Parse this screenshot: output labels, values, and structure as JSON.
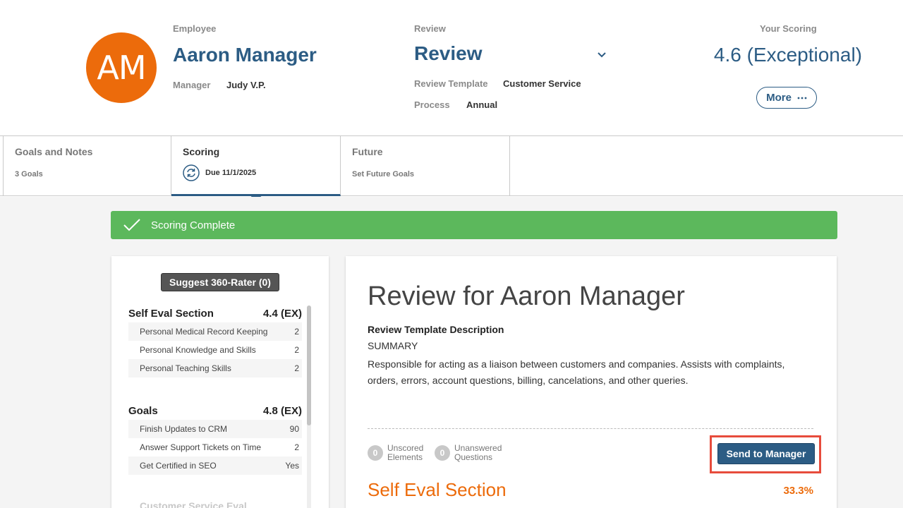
{
  "employee": {
    "label": "Employee",
    "initials": "AM",
    "name": "Aaron Manager",
    "manager_label": "Manager",
    "manager_value": "Judy V.P."
  },
  "review": {
    "label": "Review",
    "title": "Review",
    "template_label": "Review Template",
    "template_value": "Customer Service",
    "process_label": "Process",
    "process_value": "Annual"
  },
  "scoring": {
    "label": "Your Scoring",
    "value": "4.6 (Exceptional)",
    "more_label": "More",
    "more_icon": "ellipsis-icon"
  },
  "tabs": [
    {
      "title": "Goals and Notes",
      "subtitle": "3 Goals"
    },
    {
      "title": "Scoring",
      "subtitle": "Due 11/1/2025",
      "icon": "refresh-icon",
      "active": true
    },
    {
      "title": "Future",
      "subtitle": "Set Future Goals"
    }
  ],
  "banner": {
    "text": "Scoring Complete",
    "color": "#5cb85c"
  },
  "left_panel": {
    "rater_button": "Suggest 360-Rater (0)",
    "sections": [
      {
        "name": "Self Eval Section",
        "score": "4.4 (EX)",
        "items": [
          {
            "label": "Personal Medical Record Keeping",
            "value": "2"
          },
          {
            "label": "Personal Knowledge and Skills",
            "value": "2"
          },
          {
            "label": "Personal Teaching Skills",
            "value": "2"
          }
        ]
      },
      {
        "name": "Goals",
        "score": "4.8 (EX)",
        "items": [
          {
            "label": "Finish Updates to CRM",
            "value": "90"
          },
          {
            "label": "Answer Support Tickets on Time",
            "value": "2"
          },
          {
            "label": "Get Certified in SEO",
            "value": "Yes"
          }
        ]
      }
    ],
    "next_section_partial": "Customer Service Eval"
  },
  "main": {
    "title": "Review for Aaron Manager",
    "desc_label": "Review Template Description",
    "desc_summary": "SUMMARY",
    "desc_body": "Responsible for acting as a liaison between customers and companies. Assists with complaints, orders, errors, account questions, billing, cancelations, and other queries.",
    "unscored_count": "0",
    "unscored_label_1": "Unscored",
    "unscored_label_2": "Elements",
    "unanswered_count": "0",
    "unanswered_label_1": "Unanswered",
    "unanswered_label_2": "Questions",
    "send_button": "Send to Manager",
    "section_title": "Self Eval Section",
    "section_pct": "33.3%"
  },
  "colors": {
    "brand_blue": "#2c5c84",
    "accent_orange": "#ec6b0b",
    "highlight_red": "#e74c3c"
  }
}
